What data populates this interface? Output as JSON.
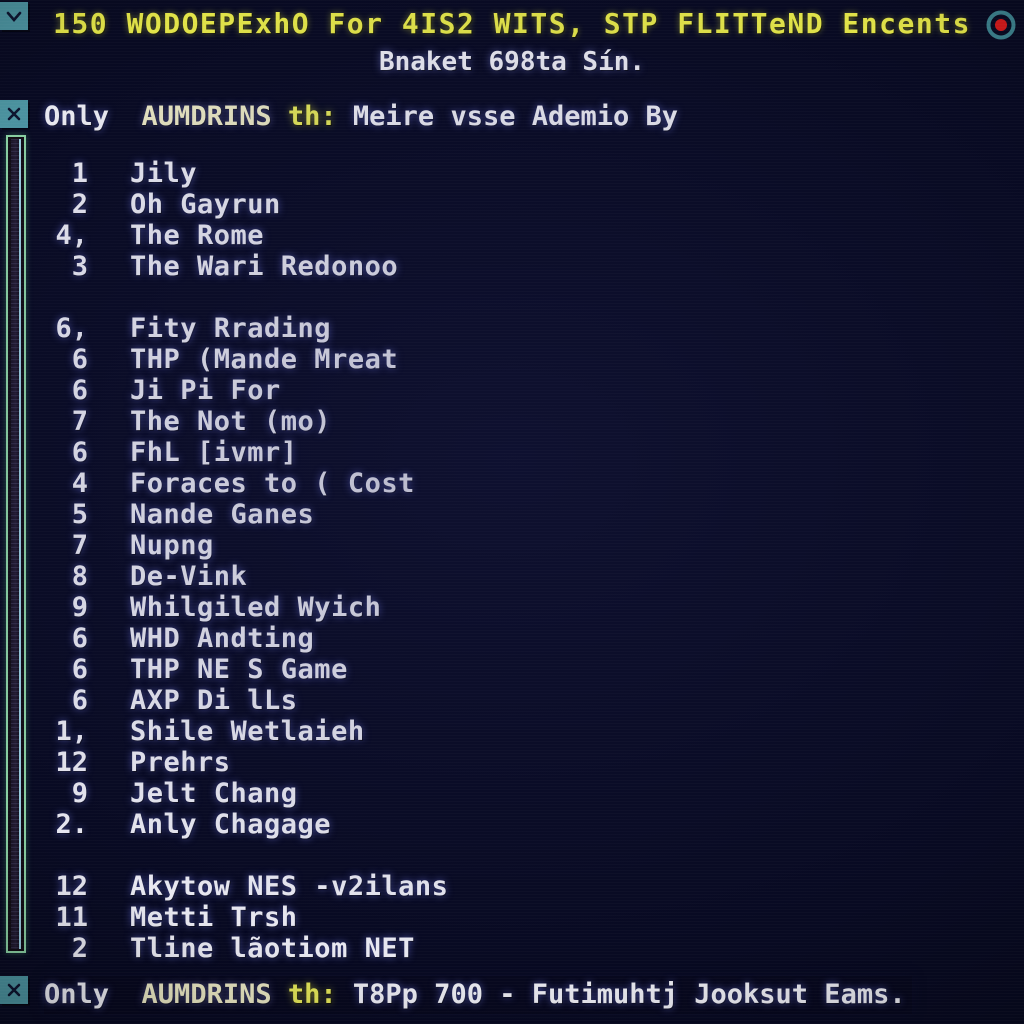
{
  "header": {
    "title": "150 WODOEPExhO For 4IS2 WITS, STP FLITTeND Encents",
    "subtitle": "Bnaket 698ta Sín.",
    "title_color": "#edef4a",
    "subtitle_color": "#f4f4fb"
  },
  "icons": {
    "collapse": "chevron-down-icon",
    "close_top": "close-icon",
    "close_bottom": "close-icon",
    "record": "record-icon",
    "record_ring_color": "#4f9aa6",
    "record_dot_color": "#e01b1b"
  },
  "section_header": {
    "prefix": "Only",
    "name": "AUMDRINS",
    "separator": "th:",
    "detail": "Meire vsse Ademio By"
  },
  "status_bar": {
    "prefix": "Only",
    "name": "AUMDRINS",
    "separator": "th:",
    "detail": "T8Pp 700 - Futimuhtj Jooksut Eams."
  },
  "scrollbar": {
    "name": "vertical-scrollbar",
    "border_color": "#8fd9a8"
  },
  "list": {
    "rows": [
      {
        "num": "1",
        "text": "Jily"
      },
      {
        "num": "2",
        "text": "Oh Gayrun"
      },
      {
        "num": "4,",
        "text": "The Rome"
      },
      {
        "num": "3",
        "text": "The Wari Redonoo"
      },
      {
        "num": "",
        "text": "",
        "spacer": true
      },
      {
        "num": "6,",
        "text": "Fity Rrading"
      },
      {
        "num": "6",
        "text": "THP (Mande Mreat"
      },
      {
        "num": "6",
        "text": "Ji Pi For"
      },
      {
        "num": "7",
        "text": "The Not (mo)"
      },
      {
        "num": "6",
        "text": "FhL [ivmr]"
      },
      {
        "num": "4",
        "text": "Foraces to ( Cost"
      },
      {
        "num": "5",
        "text": "Nande Ganes"
      },
      {
        "num": "7",
        "text": "Nupng"
      },
      {
        "num": "8",
        "text": "De-Vink"
      },
      {
        "num": "9",
        "text": "Whilgiled Wyich"
      },
      {
        "num": "6",
        "text": "WHD Andting"
      },
      {
        "num": "6",
        "text": "THP NE S Game"
      },
      {
        "num": "6",
        "text": "AXP Di lLs"
      },
      {
        "num": "1,",
        "text": "Shile Wetlaieh"
      },
      {
        "num": "12",
        "text": "Prehrs"
      },
      {
        "num": "9",
        "text": "Jelt Chang"
      },
      {
        "num": "2.",
        "text": "Anly Chagage"
      },
      {
        "num": "",
        "text": "",
        "spacer": true
      },
      {
        "num": "12",
        "text": "Akytow NES -v2ilans"
      },
      {
        "num": "11",
        "text": "Metti Trsh"
      },
      {
        "num": "2",
        "text": "Tline lãotiom NET"
      }
    ]
  },
  "theme": {
    "background": "#080a22",
    "text": "#f4f4fc",
    "accent_teal": "#4f9aa6",
    "accent_yellow": "#edef4a"
  }
}
